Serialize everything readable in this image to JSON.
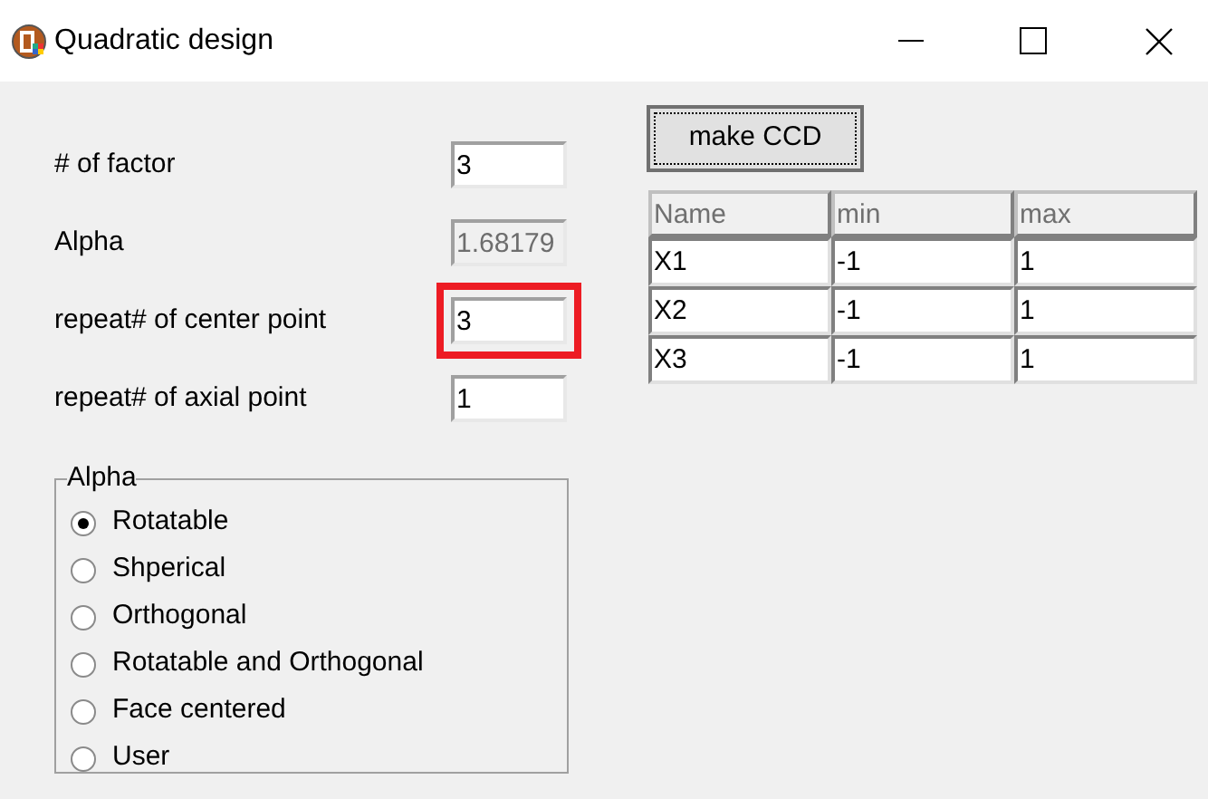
{
  "window": {
    "title": "Quadratic design"
  },
  "fields": [
    {
      "label": "# of factor",
      "value": "3",
      "disabled": false,
      "highlighted": false
    },
    {
      "label": "Alpha",
      "value": "1.68179",
      "disabled": true,
      "highlighted": false
    },
    {
      "label": "repeat# of center point",
      "value": "3",
      "disabled": false,
      "highlighted": true
    },
    {
      "label": "repeat# of axial point",
      "value": "1",
      "disabled": false,
      "highlighted": false
    }
  ],
  "alpha_group": {
    "title": "Alpha",
    "options": [
      {
        "label": "Rotatable",
        "selected": true
      },
      {
        "label": "Shperical",
        "selected": false
      },
      {
        "label": "Orthogonal",
        "selected": false
      },
      {
        "label": "Rotatable and Orthogonal",
        "selected": false
      },
      {
        "label": "Face centered",
        "selected": false
      },
      {
        "label": "User",
        "selected": false
      }
    ]
  },
  "make_button": "make CCD",
  "table": {
    "columns": [
      "Name",
      "min",
      "max"
    ],
    "rows": [
      [
        "X1",
        "-1",
        "1"
      ],
      [
        "X2",
        "-1",
        "1"
      ],
      [
        "X3",
        "-1",
        "1"
      ]
    ]
  }
}
